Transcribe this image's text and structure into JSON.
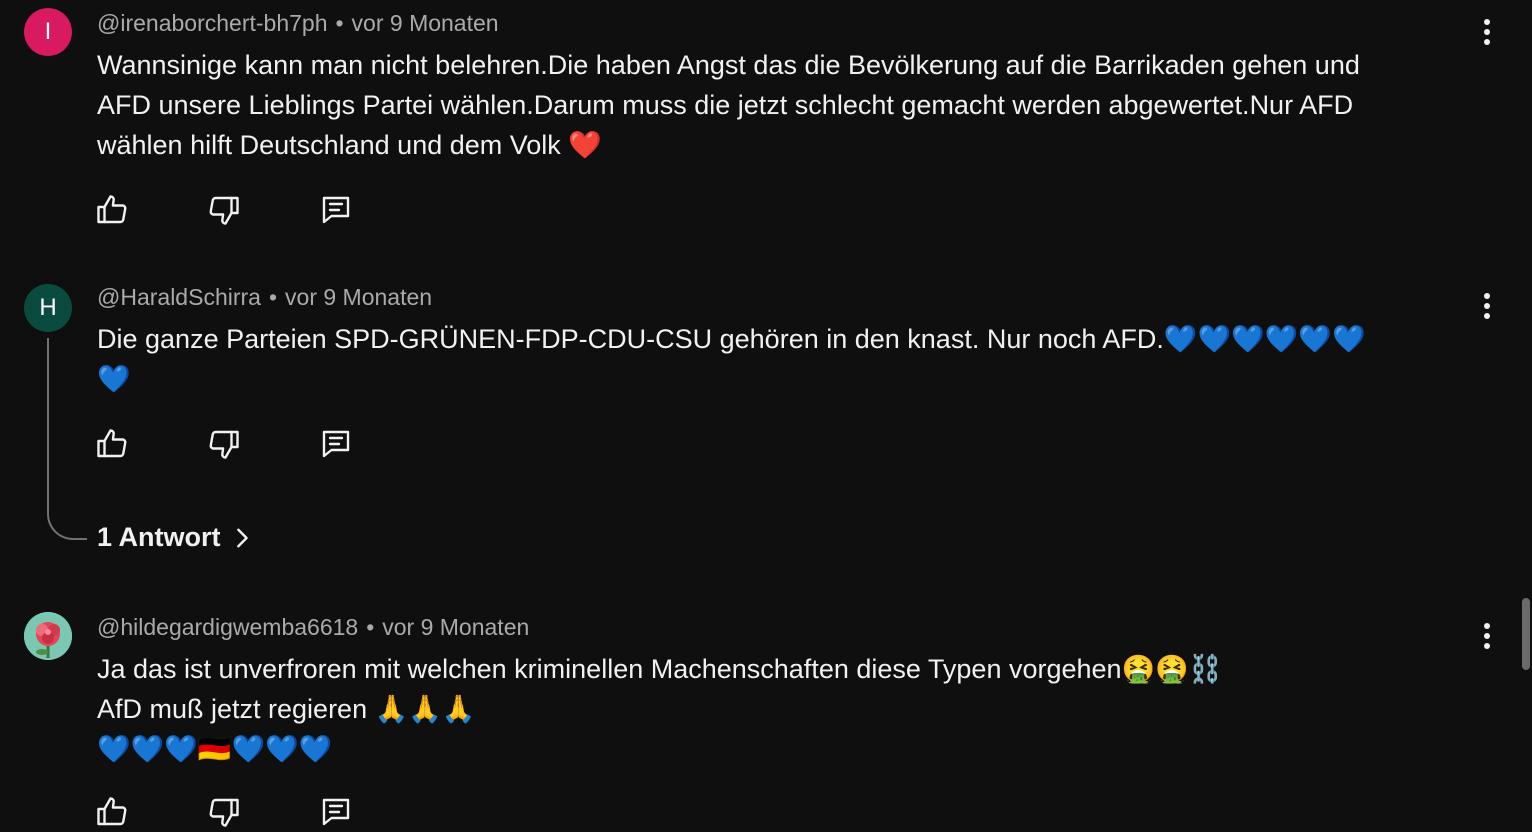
{
  "comments": [
    {
      "avatar_letter": "I",
      "avatar_color": "#d81b60",
      "author": "@irenaborchert-bh7ph",
      "time": "vor 9 Monaten",
      "lines": [
        "Wannsinige kann man nicht belehren.Die haben Angst das die Bevölkerung auf die Barrikaden gehen und",
        "AFD unsere Lieblings Partei wählen.Darum muss die jetzt schlecht gemacht werden abgewertet.Nur AFD",
        "wählen hilft Deutschland und dem Volk ❤️"
      ]
    },
    {
      "avatar_letter": "H",
      "avatar_color": "#0b4a3e",
      "author": "@HaraldSchirra",
      "time": "vor 9 Monaten",
      "lines": [
        "Die ganze Parteien SPD-GRÜNEN-FDP-CDU-CSU gehören in den knast. Nur noch AFD.💙💙💙💙💙💙",
        "💙"
      ],
      "replies_label": "1 Antwort"
    },
    {
      "avatar_color": "#7cc7b3",
      "author": "@hildegardigwemba6618",
      "time": "vor 9 Monaten",
      "lines": [
        "Ja das ist unverfroren mit welchen kriminellen Machenschaften diese Typen vorgehen🤮🤮⛓️",
        "AfD muß jetzt regieren 🙏🙏🙏",
        "💙💙💙🇩🇪💙💙💙"
      ]
    }
  ],
  "meta_separator": "•",
  "icons": {
    "like": "thumbs-up-icon",
    "dislike": "thumbs-down-icon",
    "reply": "comment-icon",
    "more": "more-vertical-icon",
    "chevron": "chevron-right-icon"
  }
}
